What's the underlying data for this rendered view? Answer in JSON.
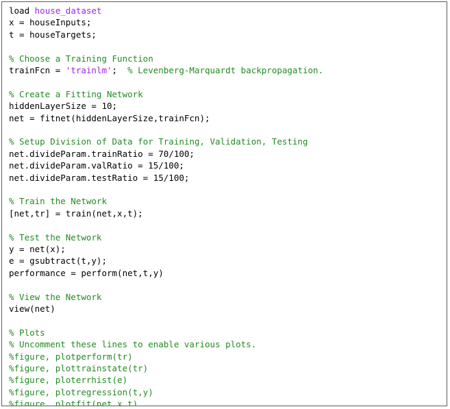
{
  "editor": {
    "colors": {
      "code": "#000000",
      "comment": "#228B22",
      "string": "#A020F0",
      "border": "#5A5A5A",
      "background": "#FFFFFF"
    },
    "lines": [
      {
        "row": 0,
        "segments": [
          {
            "type": "code",
            "text": "load "
          },
          {
            "type": "string",
            "text": "house_dataset"
          }
        ]
      },
      {
        "row": 1,
        "segments": [
          {
            "type": "code",
            "text": "x = houseInputs;"
          }
        ]
      },
      {
        "row": 2,
        "segments": [
          {
            "type": "code",
            "text": "t = houseTargets;"
          }
        ]
      },
      {
        "row": 4,
        "segments": [
          {
            "type": "comment",
            "text": "% Choose a Training Function"
          }
        ]
      },
      {
        "row": 5,
        "segments": [
          {
            "type": "code",
            "text": "trainFcn = "
          },
          {
            "type": "string",
            "text": "'trainlm'"
          },
          {
            "type": "code",
            "text": ";  "
          },
          {
            "type": "comment",
            "text": "% Levenberg-Marquardt backpropagation."
          }
        ]
      },
      {
        "row": 7,
        "segments": [
          {
            "type": "comment",
            "text": "% Create a Fitting Network"
          }
        ]
      },
      {
        "row": 8,
        "segments": [
          {
            "type": "code",
            "text": "hiddenLayerSize = 10;"
          }
        ]
      },
      {
        "row": 9,
        "segments": [
          {
            "type": "code",
            "text": "net = fitnet(hiddenLayerSize,trainFcn);"
          }
        ]
      },
      {
        "row": 11,
        "segments": [
          {
            "type": "comment",
            "text": "% Setup Division of Data for Training, Validation, Testing"
          }
        ]
      },
      {
        "row": 12,
        "segments": [
          {
            "type": "code",
            "text": "net.divideParam.trainRatio = 70/100;"
          }
        ]
      },
      {
        "row": 13,
        "segments": [
          {
            "type": "code",
            "text": "net.divideParam.valRatio = 15/100;"
          }
        ]
      },
      {
        "row": 14,
        "segments": [
          {
            "type": "code",
            "text": "net.divideParam.testRatio = 15/100;"
          }
        ]
      },
      {
        "row": 16,
        "segments": [
          {
            "type": "comment",
            "text": "% Train the Network"
          }
        ]
      },
      {
        "row": 17,
        "segments": [
          {
            "type": "code",
            "text": "[net,tr] = train(net,x,t);"
          }
        ]
      },
      {
        "row": 19,
        "segments": [
          {
            "type": "comment",
            "text": "% Test the Network"
          }
        ]
      },
      {
        "row": 20,
        "segments": [
          {
            "type": "code",
            "text": "y = net(x);"
          }
        ]
      },
      {
        "row": 21,
        "segments": [
          {
            "type": "code",
            "text": "e = gsubtract(t,y);"
          }
        ]
      },
      {
        "row": 22,
        "segments": [
          {
            "type": "code",
            "text": "performance = perform(net,t,y)"
          }
        ]
      },
      {
        "row": 24,
        "segments": [
          {
            "type": "comment",
            "text": "% View the Network"
          }
        ]
      },
      {
        "row": 25,
        "segments": [
          {
            "type": "code",
            "text": "view(net)"
          }
        ]
      },
      {
        "row": 27,
        "segments": [
          {
            "type": "comment",
            "text": "% Plots"
          }
        ]
      },
      {
        "row": 28,
        "segments": [
          {
            "type": "comment",
            "text": "% Uncomment these lines to enable various plots."
          }
        ]
      },
      {
        "row": 29,
        "segments": [
          {
            "type": "comment",
            "text": "%figure, plotperform(tr)"
          }
        ]
      },
      {
        "row": 30,
        "segments": [
          {
            "type": "comment",
            "text": "%figure, plottrainstate(tr)"
          }
        ]
      },
      {
        "row": 31,
        "segments": [
          {
            "type": "comment",
            "text": "%figure, ploterrhist(e)"
          }
        ]
      },
      {
        "row": 32,
        "segments": [
          {
            "type": "comment",
            "text": "%figure, plotregression(t,y)"
          }
        ]
      },
      {
        "row": 33,
        "segments": [
          {
            "type": "comment",
            "text": "%figure, plotfit(net,x,t)"
          }
        ]
      }
    ]
  }
}
